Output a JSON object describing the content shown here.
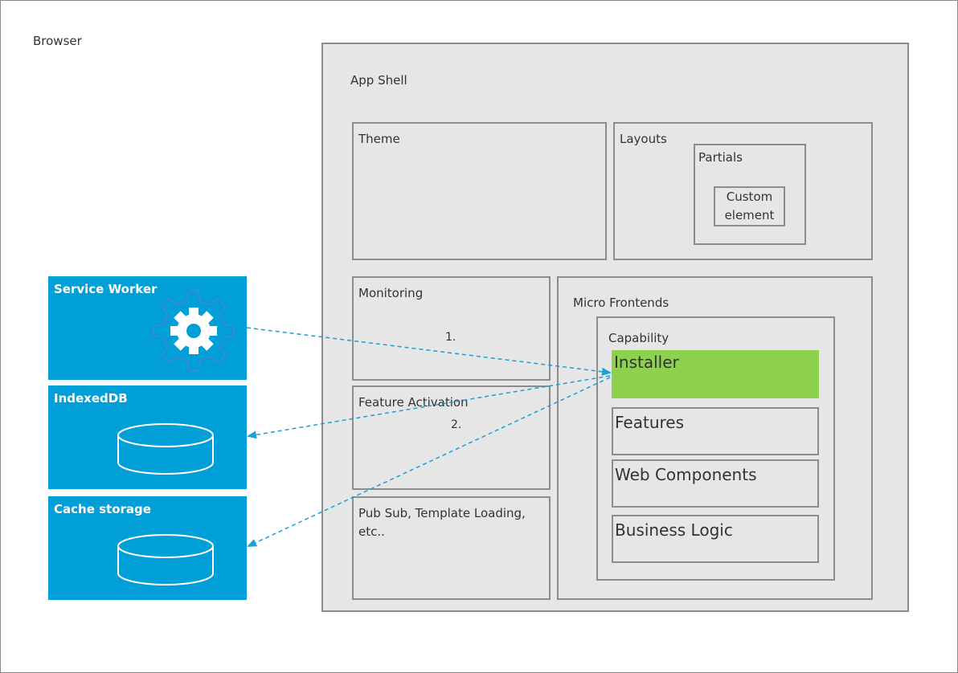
{
  "browser": {
    "label": "Browser"
  },
  "app_shell": {
    "label": "App Shell",
    "theme": "Theme",
    "layouts": {
      "label": "Layouts",
      "partials": "Partials",
      "custom_element": "Custom element"
    },
    "monitoring": "Monitoring",
    "feature_activation": "Feature Activation",
    "pubsub": "Pub Sub, Template Loading, etc..",
    "micro_frontends": {
      "label": "Micro Frontends",
      "capability": {
        "label": "Capability",
        "installer": "Installer",
        "features": "Features",
        "web_components": "Web Components",
        "business_logic": "Business Logic"
      }
    }
  },
  "side": {
    "service_worker": "Service Worker",
    "indexeddb": "IndexedDB",
    "cache_storage": "Cache storage"
  },
  "annotations": {
    "step1": "1.",
    "step2": "2."
  },
  "colors": {
    "blue": "#009fd8",
    "green": "#8ed14f",
    "arrow": "#1a9fd8"
  },
  "icons": {
    "service_worker": "gear-icon",
    "storage": "database-icon"
  }
}
